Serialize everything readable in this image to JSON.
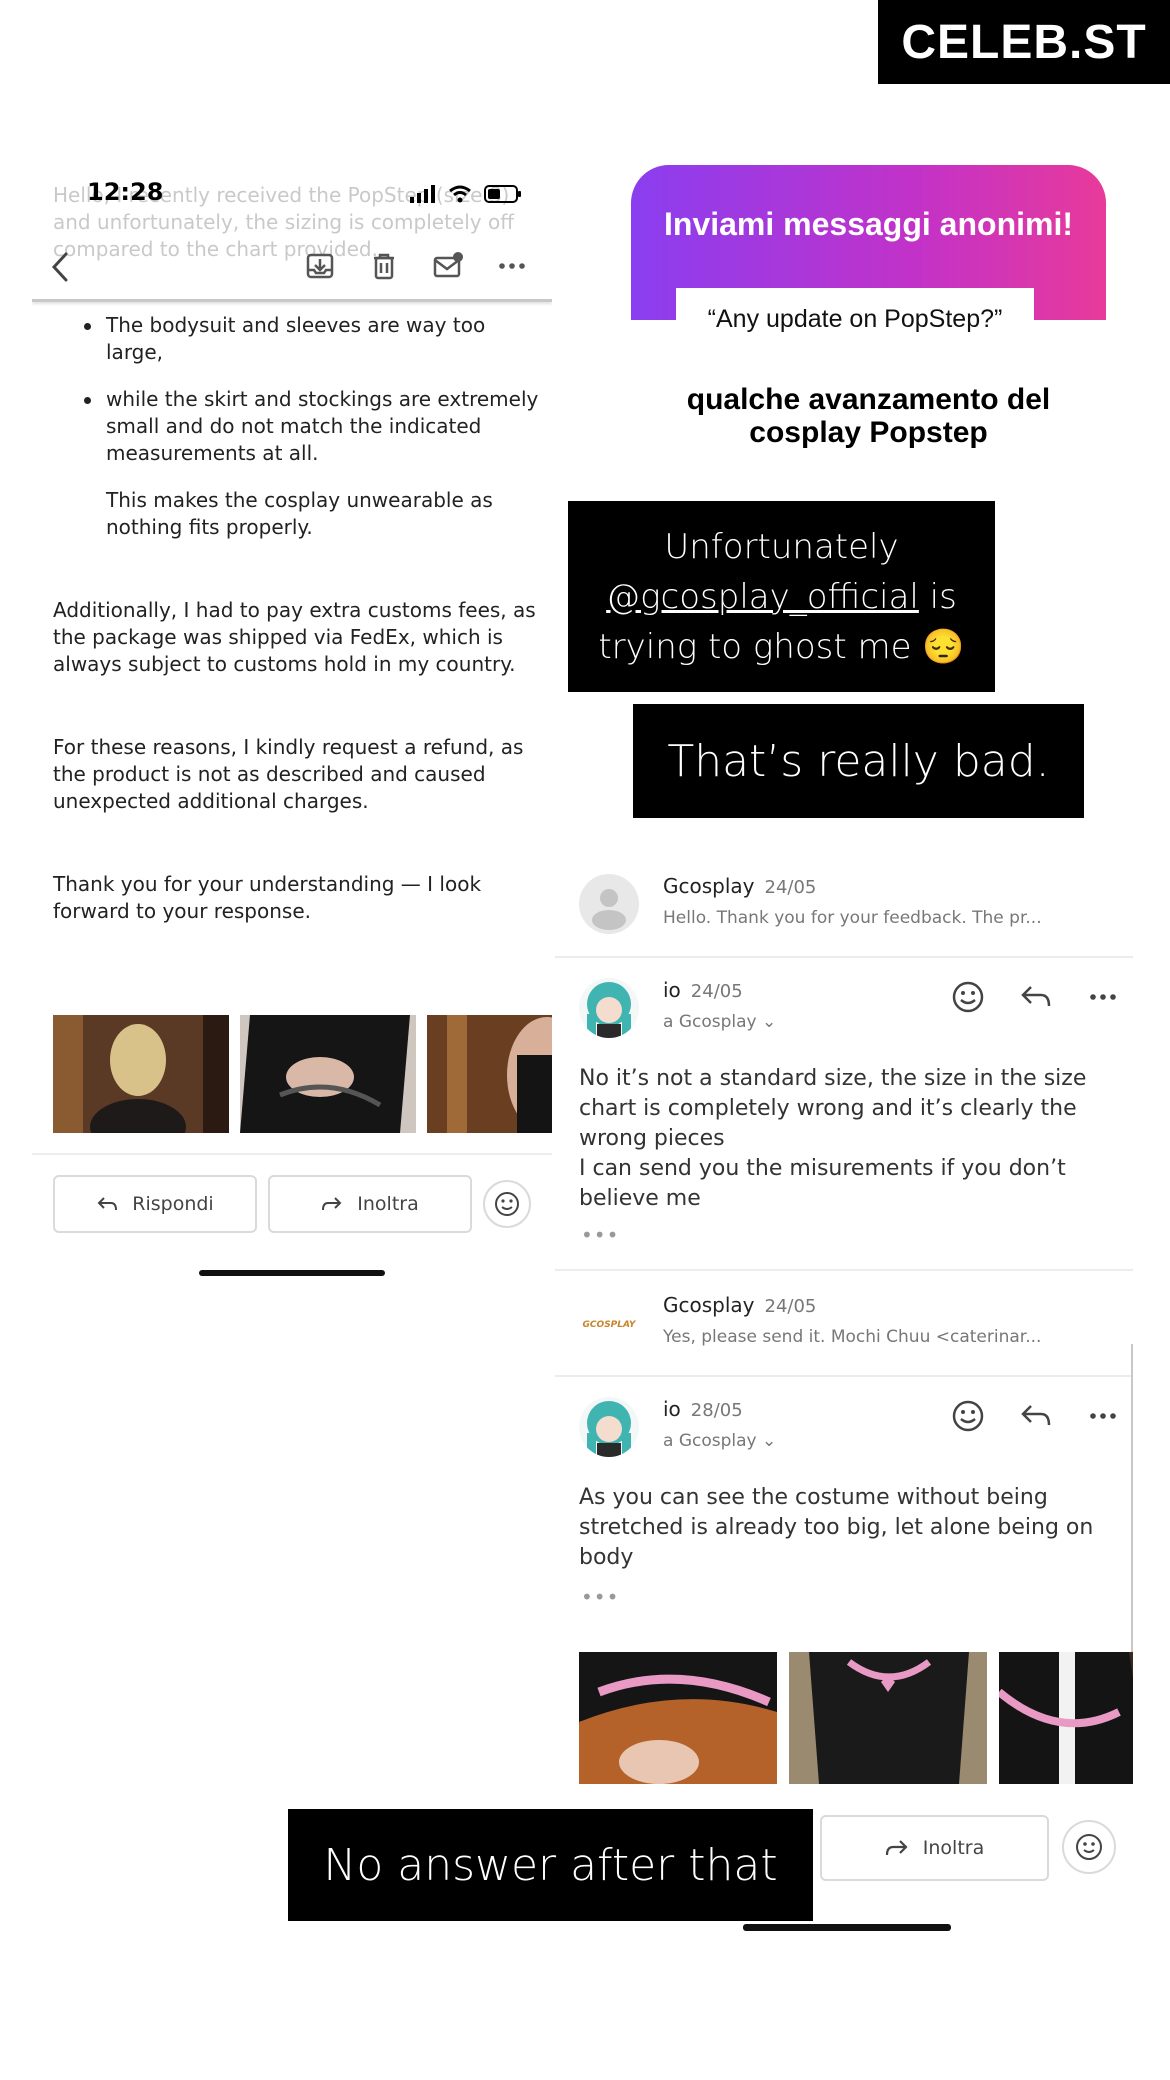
{
  "watermark": "CELEB.ST",
  "email": {
    "ghost_text": "Hello, I recently received the PopStep (size S) and unfortunately, the sizing is completely off compared to the chart provided.",
    "status_time": "12:28",
    "bullets": [
      "The bodysuit and sleeves are way too large,",
      "while the skirt and stockings are extremely small and do not match the indicated measurements at all."
    ],
    "indent_text": "This makes the cosplay unwearable as nothing fits properly.",
    "paragraphs": [
      "Additionally, I had to pay extra customs fees, as the package was shipped via FedEx, which is always subject to customs hold in my country.",
      "For these reasons, I kindly request a refund, as the product is not as described and caused unexpected additional charges.",
      "Thank you for your understanding — I look forward to your response."
    ],
    "reply_label": "Rispondi",
    "forward_label": "Inoltra"
  },
  "question_card": {
    "title": "Inviami messaggi anonimi!",
    "question": "“Any update on PopStep?”",
    "answer": "qualche avanzamento del cosplay Popstep"
  },
  "captions": {
    "ghost_prefix": "Unfortunately",
    "ghost_mention": "@gcosplay_official",
    "ghost_suffix": "is trying to ghost me 😔",
    "bad": "That’s really bad.",
    "no_answer": "No answer after that"
  },
  "thread": {
    "messages": [
      {
        "sender": "Gcosplay",
        "date": "24/05",
        "preview": "Hello. Thank you for your feedback. The pr..."
      },
      {
        "sender": "io",
        "date": "24/05",
        "to": "a Gcosplay",
        "body_lines": [
          "No it’s not a standard size, the size in the size chart is completely wrong and it’s clearly the wrong pieces",
          "I can send you the misurements if you don’t believe me"
        ]
      },
      {
        "sender": "Gcosplay",
        "date": "24/05",
        "preview": "Yes, please send it. Mochi Chuu <caterinar...",
        "logo_text": "GCOSPLAY"
      },
      {
        "sender": "io",
        "date": "28/05",
        "to": "a Gcosplay",
        "body": "As you can see the costume without being stretched is already too big, let alone being on body"
      }
    ],
    "forward_label": "Inoltra"
  },
  "colors": {
    "accent_purple": "#8a3ef0",
    "accent_pink": "#e83a9a",
    "caption_bg": "#000000"
  }
}
